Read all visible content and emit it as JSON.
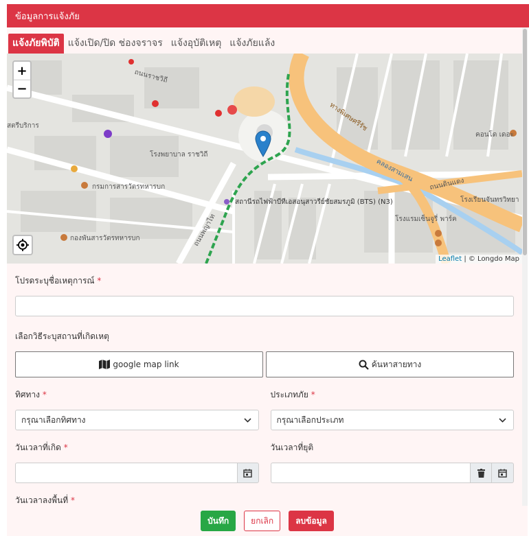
{
  "modal": {
    "title": "ข้อมูลการแจ้งภัย"
  },
  "tabs": [
    {
      "label": "แจ้งภัยพิบัติ",
      "active": true
    },
    {
      "label": "แจ้งเปิด/ปิด ช่องจราจร",
      "active": false
    },
    {
      "label": "แจ้งอุบัติเหตุ",
      "active": false
    },
    {
      "label": "แจ้งภัยแล้ง",
      "active": false
    }
  ],
  "map": {
    "zoom_in": "+",
    "zoom_out": "−",
    "attribution_leaflet": "Leaflet",
    "attribution_rest": " | © Longdo Map",
    "labels": {
      "road_rajvithi": "ถนนราชวิถี",
      "hospital": "โรงพยาบาล ราชวิถี",
      "dept": "กรมการสารวัตรทหารบก",
      "dept2": "กองพันสารวัตรทหารบก",
      "bts": "สถานีรถไฟฟ้าบีทีเอสอนุสาวรีย์ชัยสมรภูมิ (BTS) (N3)",
      "expressway": "ทางพิเศษศรีรัช",
      "canal": "คลองสามเสน",
      "road_dindaeng": "ถนนดินแดง",
      "school": "โรงเรียนจันทรวิทยา",
      "service": "สตรีบริการ",
      "phayathai": "ถนนพญาไท",
      "condo": "คอนโด เดอะ",
      "hotel": "โรงแรมเซ็นจูรี่ พาร์ค"
    }
  },
  "form": {
    "event_name_label": "โปรดระบุชื่อเหตุการณ์",
    "event_name_value": "",
    "location_method_label": "เลือกวิธีระบุสถานที่เกิดเหตุ",
    "google_map_btn": "google map link",
    "search_route_btn": "ค้นหาสายทาง",
    "direction_label": "ทิศทาง",
    "direction_selected": "กรุณาเลือกทิศทาง",
    "type_label": "ประเภทภัย",
    "type_selected": "กรุณาเลือกประเภท",
    "start_datetime_label": "วันเวลาที่เกิด",
    "end_datetime_label": "วันเวลาที่ยุติ",
    "area_datetime_label": "วันเวลาลงพื้นที่",
    "required_mark": "*"
  },
  "footer": {
    "save": "บันทึก",
    "cancel": "ยกเลิก",
    "delete": "ลบข้อมูล"
  },
  "colors": {
    "header": "#dc3545",
    "save": "#28a745",
    "marker": "#2a81cb",
    "expressway": "#f7c27b"
  }
}
